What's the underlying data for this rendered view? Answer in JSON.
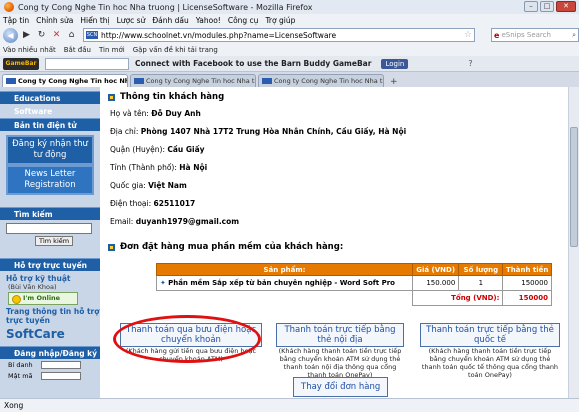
{
  "window": {
    "title": "Cong ty Cong Nghe Tin hoc Nha truong | LicenseSoftware - Mozilla Firefox"
  },
  "menu": [
    "Tập tin",
    "Chỉnh sửa",
    "Hiển thị",
    "Lược sử",
    "Đánh dấu",
    "Yahoo!",
    "Công cụ",
    "Trợ giúp"
  ],
  "nav": {
    "url": "http://www.schoolnet.vn/modules.php?name=LicenseSoftware",
    "favicon": "SCN",
    "search_placeholder": "eSnips Search"
  },
  "bookmarks": [
    "Vào nhiều nhất",
    "Bắt đầu",
    "Tin mới",
    "Gặp vấn đề khi tải trang"
  ],
  "toolbar2": {
    "logo": "GameBar",
    "facebook": "Connect with Facebook to use the Barn Buddy GameBar",
    "login": "Login"
  },
  "tabs": [
    {
      "label": "Cong ty Cong Nghe Tin hoc Nha tr..."
    },
    {
      "label": "Cong ty Cong Nghe Tin hoc Nha tr..."
    },
    {
      "label": "Cong ty Cong Nghe Tin hoc Nha tr..."
    }
  ],
  "sidebar": {
    "educations": "Educations Software",
    "newsletter_head": "Bản tin điện tử",
    "newsletter_line1": "Đăng ký nhận thư tư động",
    "newsletter_line2": "News Letter Registration",
    "search_head": "Tìm kiếm",
    "search_btn": "Tìm kiếm",
    "support_head": "Hỗ trợ trực tuyến",
    "tech_support": "Hỗ trợ kỹ thuật",
    "tech_person": "(Bùi Văn Khoa)",
    "im_online": "I'm Online",
    "online_support": "Trang thông tin hỗ trợ trực tuyến",
    "softcare": "SoftCare",
    "login_head": "Đăng nhập/Đăng ký",
    "login_label": "Bí danh",
    "password_label": "Mật mã"
  },
  "customer": {
    "title": "Thông tin khách hàng",
    "name_label": "Họ và tên:",
    "name": "Đỗ Duy Anh",
    "address_label": "Địa chỉ:",
    "address": "Phòng 1407 Nhà 17T2 Trung Hòa Nhân Chính, Cầu Giấy, Hà Nội",
    "district_label": "Quận (Huyện):",
    "district": "Cầu Giấy",
    "province_label": "Tỉnh (Thành phố):",
    "province": "Hà Nội",
    "country_label": "Quốc gia:",
    "country": "Việt Nam",
    "phone_label": "Điện thoại:",
    "phone": "62511017",
    "email_label": "Email:",
    "email": "duyanh1979@gmail.com"
  },
  "order": {
    "title": "Đơn đặt hàng mua phần mềm của khách hàng:",
    "headers": [
      "Sản phẩm:",
      "Giá (VND)",
      "Số lượng",
      "Thành tiền"
    ],
    "row": {
      "product": "Phần mềm Sắp xếp từ bản chuyên nghiệp - Word Soft Pro",
      "price": "150.000",
      "qty": "1",
      "amount": "150000"
    },
    "total_label": "Tổng (VND):",
    "total": "150000"
  },
  "payment": {
    "postal_btn": "Thanh toán qua bưu điện hoặc chuyển khoản",
    "postal_desc": "(Khách hàng gửi tiền qua bưu điện hoặc chuyển khoản ATM)",
    "domestic_btn": "Thanh toán trực tiếp bằng thẻ nội địa",
    "domestic_desc": "(Khách hàng thanh toán tiền trực tiếp bằng chuyển khoản ATM sử dụng thẻ thanh toán nội địa thông qua cổng thanh toán OnePay)",
    "intl_btn": "Thanh toán trực tiếp bằng thẻ quốc tế",
    "intl_desc": "(Khách hàng thanh toán tiền trực tiếp bằng chuyển khoản ATM sử dụng thẻ thanh toán quốc tế thông qua cổng thanh toán OnePay)",
    "change_btn": "Thay đổi đơn hàng"
  },
  "status": "Xong",
  "colors": {
    "sidebar_head": "#1f5fa6",
    "table_head": "#e67a00",
    "highlight": "#e01010"
  }
}
